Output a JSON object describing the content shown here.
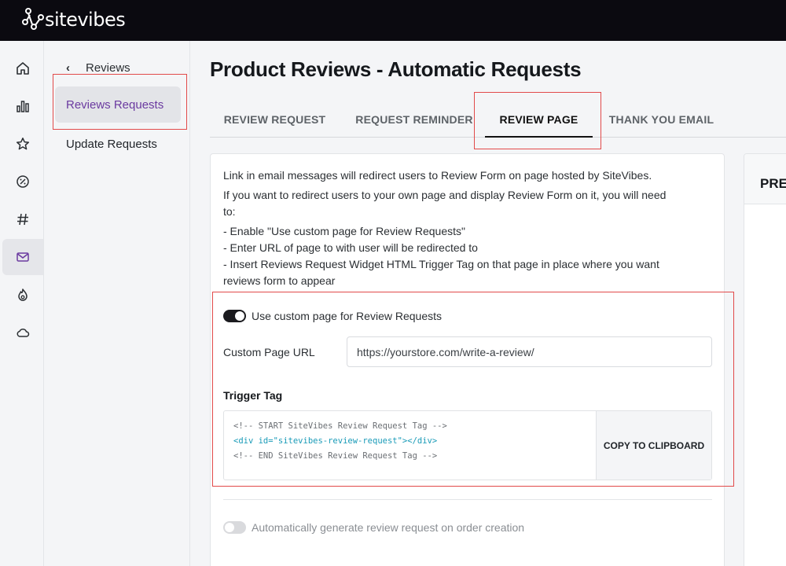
{
  "app": {
    "brand": "sitevibes"
  },
  "rail": {
    "icons": [
      "home-icon",
      "chart-icon",
      "star-icon",
      "discount-icon",
      "hashtag-icon",
      "mail-icon",
      "flame-icon",
      "cloud-icon"
    ]
  },
  "subnav": {
    "back_label": "Reviews",
    "items": [
      {
        "label": "Reviews Requests",
        "active": true
      },
      {
        "label": "Update Requests",
        "active": false
      }
    ]
  },
  "page": {
    "title": "Product Reviews - Automatic Requests"
  },
  "tabs": [
    {
      "label": "REVIEW REQUEST",
      "active": false
    },
    {
      "label": "REQUEST REMINDER",
      "active": false
    },
    {
      "label": "REVIEW PAGE",
      "active": true
    },
    {
      "label": "THANK YOU EMAIL",
      "active": false
    }
  ],
  "review_page": {
    "intro_1": "Link in email messages will redirect users to Review Form on page hosted by SiteVibes.",
    "intro_2a": "If you want to redirect users to your own page and display Review Form on it, you will need",
    "intro_2b": "to:",
    "step_1": "- Enable \"Use custom page for Review Requests\"",
    "step_2": "- Enter URL of page to with user will be redirected to",
    "step_3a": "- Insert Reviews Request Widget HTML Trigger Tag on that page in place where you want",
    "step_3b": "reviews form to appear",
    "custom_page_toggle": {
      "label": "Use custom page for Review Requests",
      "on": true
    },
    "url_label": "Custom Page URL",
    "url_value": "https://yourstore.com/write-a-review/",
    "trigger_title": "Trigger Tag",
    "code_line_1": "<!-- START SiteVibes Review Request Tag -->",
    "code_line_2": "<div id=\"sitevibes-review-request\"></div>",
    "code_line_3": "<!-- END SiteVibes Review Request Tag -->",
    "copy_label": "COPY TO CLIPBOARD",
    "auto_toggle": {
      "label": "Automatically generate review request on order creation",
      "on": false
    }
  },
  "preview": {
    "title": "PREVIEW"
  },
  "colors": {
    "topbar": "#0b0a10",
    "accent_purple": "#6b3aa0",
    "highlight_red": "#e24a4a",
    "code_tag": "#1a9bb8"
  }
}
